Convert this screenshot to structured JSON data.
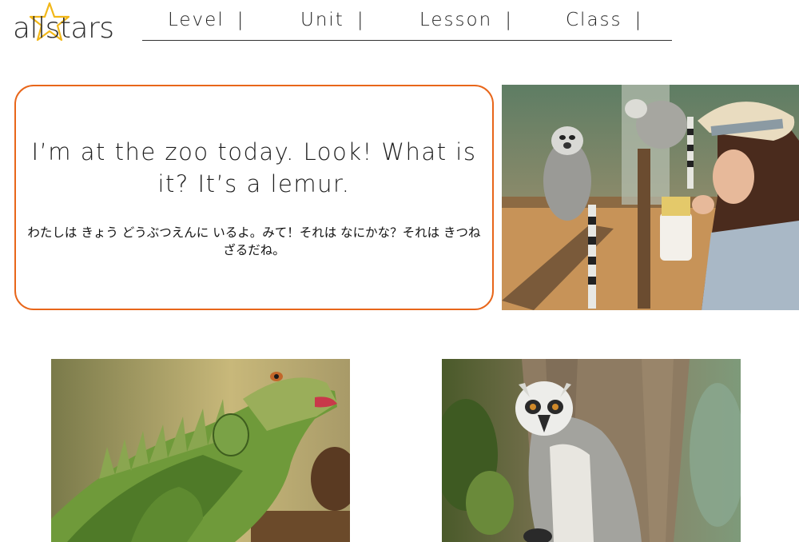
{
  "logo": {
    "text": "allstars",
    "star_color": "#f2b718"
  },
  "nav": {
    "items": [
      {
        "label": "Level",
        "separator": "|"
      },
      {
        "label": "Unit",
        "separator": "|"
      },
      {
        "label": "Lesson",
        "separator": "|"
      },
      {
        "label": "Class",
        "separator": "|"
      }
    ]
  },
  "card": {
    "english": "I’m at the zoo today. Look! What is it? It’s a lemur.",
    "japanese": "わたしは きょう どうぶつえんに いるよ。みて！それは なにかな？それは きつねざるだね。",
    "border_color": "#e8661a"
  },
  "photos": {
    "top_right": "girl-with-lemurs-photo",
    "bottom_left": "iguana-photo",
    "bottom_right": "lemur-photo"
  }
}
